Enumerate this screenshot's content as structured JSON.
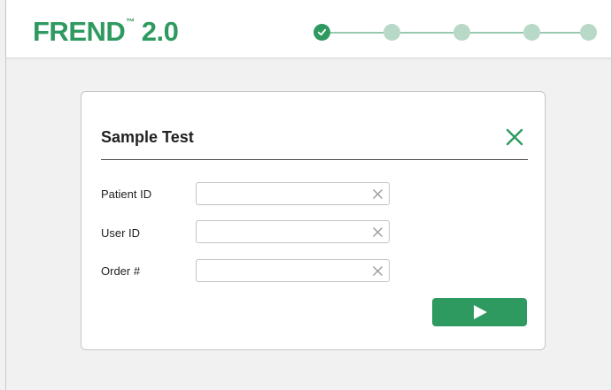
{
  "header": {
    "logo_brand": "FREND",
    "logo_tm": "™",
    "logo_version": "2.0",
    "progress": {
      "total_steps": 5,
      "completed_steps": 1
    }
  },
  "dialog": {
    "title": "Sample Test",
    "close_icon": "close-icon",
    "fields": [
      {
        "label": "Patient ID",
        "value": "",
        "placeholder": ""
      },
      {
        "label": "User ID",
        "value": "",
        "placeholder": ""
      },
      {
        "label": "Order #",
        "value": "",
        "placeholder": ""
      }
    ],
    "submit_icon": "play-icon"
  },
  "colors": {
    "accent": "#2e9a60",
    "step_pending": "#b8d9c8",
    "background": "#f1f1f1"
  }
}
